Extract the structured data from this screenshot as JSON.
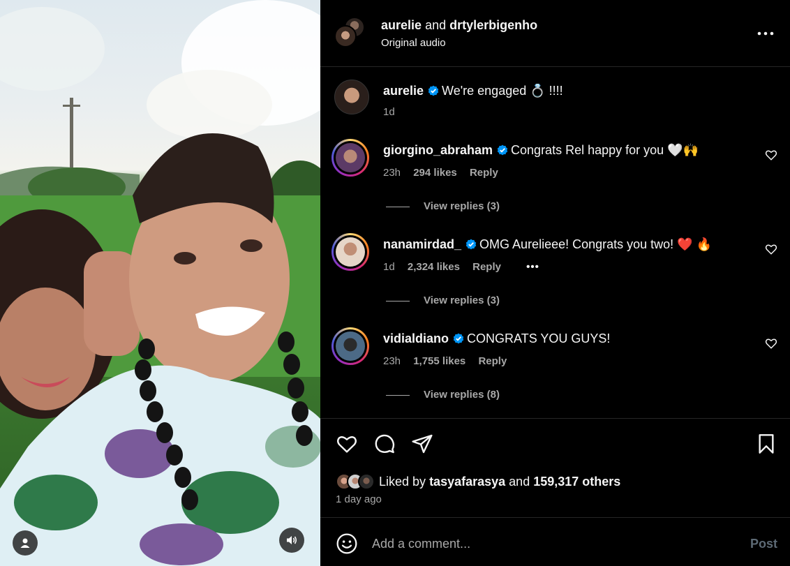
{
  "header": {
    "user1": "aurelie",
    "joiner": "and",
    "user2": "drtylerbigenho",
    "audio": "Original audio",
    "more_icon": "more-horizontal-icon"
  },
  "caption": {
    "username": "aurelie",
    "text": "We're engaged 💍 !!!!",
    "age": "1d"
  },
  "comments": [
    {
      "username": "giorgino_abraham",
      "text": "Congrats Rel happy for you 🤍🙌",
      "age": "23h",
      "likes": "294 likes",
      "reply": "Reply",
      "replies": "View replies (3)",
      "more": ""
    },
    {
      "username": "nanamirdad_",
      "text": "OMG Aurelieee! Congrats you two! ❤️ 🔥",
      "age": "1d",
      "likes": "2,324 likes",
      "reply": "Reply",
      "replies": "View replies (3)",
      "more": "•••"
    },
    {
      "username": "vidialdiano",
      "text": "CONGRATS YOU GUYS!",
      "age": "23h",
      "likes": "1,755 likes",
      "reply": "Reply",
      "replies": "View replies (8)",
      "more": ""
    }
  ],
  "likes": {
    "prefix": "Liked by",
    "user": "tasyafarasya",
    "joiner": "and",
    "others": "159,317 others",
    "when": "1 day ago"
  },
  "composer": {
    "placeholder": "Add a comment...",
    "post": "Post"
  },
  "colors": {
    "verified": "#0095f6",
    "muted": "#a8a8a8",
    "post_disabled": "#5d6a75"
  }
}
